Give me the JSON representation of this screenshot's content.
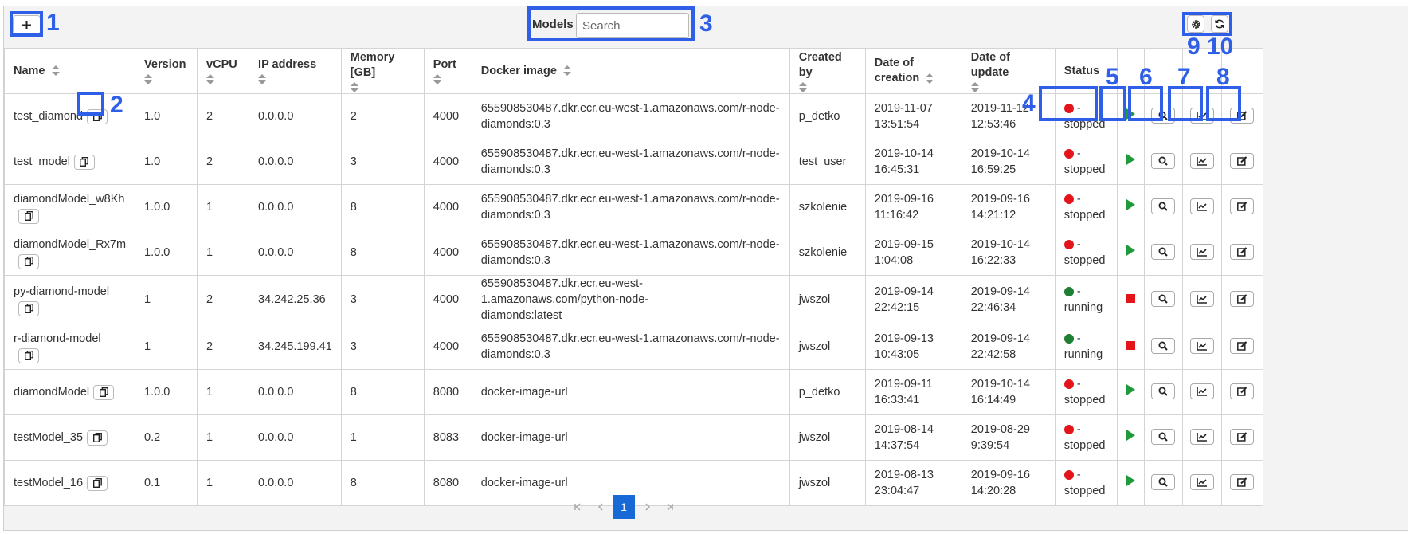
{
  "toolbar": {
    "add_icon": "plus-icon",
    "models_label": "Models",
    "search_placeholder": "Search",
    "settings_icon": "gear-icon",
    "refresh_icon": "refresh-icon"
  },
  "annotations": [
    "1",
    "2",
    "3",
    "4",
    "5",
    "6",
    "7",
    "8",
    "9",
    "10"
  ],
  "columns": {
    "name": "Name",
    "version": "Version",
    "vcpu": "vCPU",
    "ip": "IP address",
    "memory": "Memory [GB]",
    "port": "Port",
    "docker": "Docker image",
    "created_by": "Created by",
    "date_creation_1": "Date of",
    "date_creation_2": "creation",
    "date_update": "Date of update",
    "status": "Status"
  },
  "rows": [
    {
      "name": "test_diamond",
      "version": "1.0",
      "vcpu": "2",
      "ip": "0.0.0.0",
      "memory": "2",
      "port": "4000",
      "docker_1": "655908530487.dkr.ecr.eu-west-1.amazonaws.com/r-node-",
      "docker_2": "diamonds:0.3",
      "created_by": "p_detko",
      "created_1": "2019-11-07",
      "created_2": "13:51:54",
      "updated_1": "2019-11-12",
      "updated_2": "12:53:46",
      "status_1": "-",
      "status_2": "stopped",
      "running": false
    },
    {
      "name": "test_model",
      "version": "1.0",
      "vcpu": "2",
      "ip": "0.0.0.0",
      "memory": "3",
      "port": "4000",
      "docker_1": "655908530487.dkr.ecr.eu-west-1.amazonaws.com/r-node-",
      "docker_2": "diamonds:0.3",
      "created_by": "test_user",
      "created_1": "2019-10-14",
      "created_2": "16:45:31",
      "updated_1": "2019-10-14",
      "updated_2": "16:59:25",
      "status_1": "-",
      "status_2": "stopped",
      "running": false
    },
    {
      "name": "diamondModel_w8Kh",
      "version": "1.0.0",
      "vcpu": "1",
      "ip": "0.0.0.0",
      "memory": "8",
      "port": "4000",
      "docker_1": "655908530487.dkr.ecr.eu-west-1.amazonaws.com/r-node-",
      "docker_2": "diamonds:0.3",
      "created_by": "szkolenie",
      "created_1": "2019-09-16",
      "created_2": "11:16:42",
      "updated_1": "2019-09-16",
      "updated_2": "14:21:12",
      "status_1": "-",
      "status_2": "stopped",
      "running": false
    },
    {
      "name": "diamondModel_Rx7m",
      "version": "1.0.0",
      "vcpu": "1",
      "ip": "0.0.0.0",
      "memory": "8",
      "port": "4000",
      "docker_1": "655908530487.dkr.ecr.eu-west-1.amazonaws.com/r-node-",
      "docker_2": "diamonds:0.3",
      "created_by": "szkolenie",
      "created_1": "2019-09-15",
      "created_2": "1:04:08",
      "updated_1": "2019-10-14",
      "updated_2": "16:22:33",
      "status_1": "-",
      "status_2": "stopped",
      "running": false
    },
    {
      "name": "py-diamond-model",
      "version": "1",
      "vcpu": "2",
      "ip": "34.242.25.36",
      "memory": "3",
      "port": "4000",
      "docker_1": "655908530487.dkr.ecr.eu-west-1.amazonaws.com/python-node-",
      "docker_2": "diamonds:latest",
      "created_by": "jwszol",
      "created_1": "2019-09-14",
      "created_2": "22:42:15",
      "updated_1": "2019-09-14",
      "updated_2": "22:46:34",
      "status_1": "-",
      "status_2": "running",
      "running": true
    },
    {
      "name": "r-diamond-model",
      "version": "1",
      "vcpu": "2",
      "ip": "34.245.199.41",
      "memory": "3",
      "port": "4000",
      "docker_1": "655908530487.dkr.ecr.eu-west-1.amazonaws.com/r-node-",
      "docker_2": "diamonds:0.3",
      "created_by": "jwszol",
      "created_1": "2019-09-13",
      "created_2": "10:43:05",
      "updated_1": "2019-09-14",
      "updated_2": "22:42:58",
      "status_1": "-",
      "status_2": "running",
      "running": true
    },
    {
      "name": "diamondModel",
      "version": "1.0.0",
      "vcpu": "1",
      "ip": "0.0.0.0",
      "memory": "8",
      "port": "8080",
      "docker_1": "docker-image-url",
      "docker_2": "",
      "created_by": "p_detko",
      "created_1": "2019-09-11",
      "created_2": "16:33:41",
      "updated_1": "2019-10-14",
      "updated_2": "16:14:49",
      "status_1": "-",
      "status_2": "stopped",
      "running": false
    },
    {
      "name": "testModel_35",
      "version": "0.2",
      "vcpu": "1",
      "ip": "0.0.0.0",
      "memory": "1",
      "port": "8083",
      "docker_1": "docker-image-url",
      "docker_2": "",
      "created_by": "jwszol",
      "created_1": "2019-08-14",
      "created_2": "14:37:54",
      "updated_1": "2019-08-29",
      "updated_2": "9:39:54",
      "status_1": "-",
      "status_2": "stopped",
      "running": false
    },
    {
      "name": "testModel_16",
      "version": "0.1",
      "vcpu": "1",
      "ip": "0.0.0.0",
      "memory": "8",
      "port": "8080",
      "docker_1": "docker-image-url",
      "docker_2": "",
      "created_by": "jwszol",
      "created_1": "2019-08-13",
      "created_2": "23:04:47",
      "updated_1": "2019-09-16",
      "updated_2": "14:20:28",
      "status_1": "-",
      "status_2": "stopped",
      "running": false
    }
  ],
  "colors": {
    "running": "#1e7e34",
    "stopped": "#e3151b",
    "play": "#1e9a3a",
    "annotation": "#2f5fe6",
    "pager_active": "#1769d6"
  },
  "pagination": {
    "current": "1"
  }
}
